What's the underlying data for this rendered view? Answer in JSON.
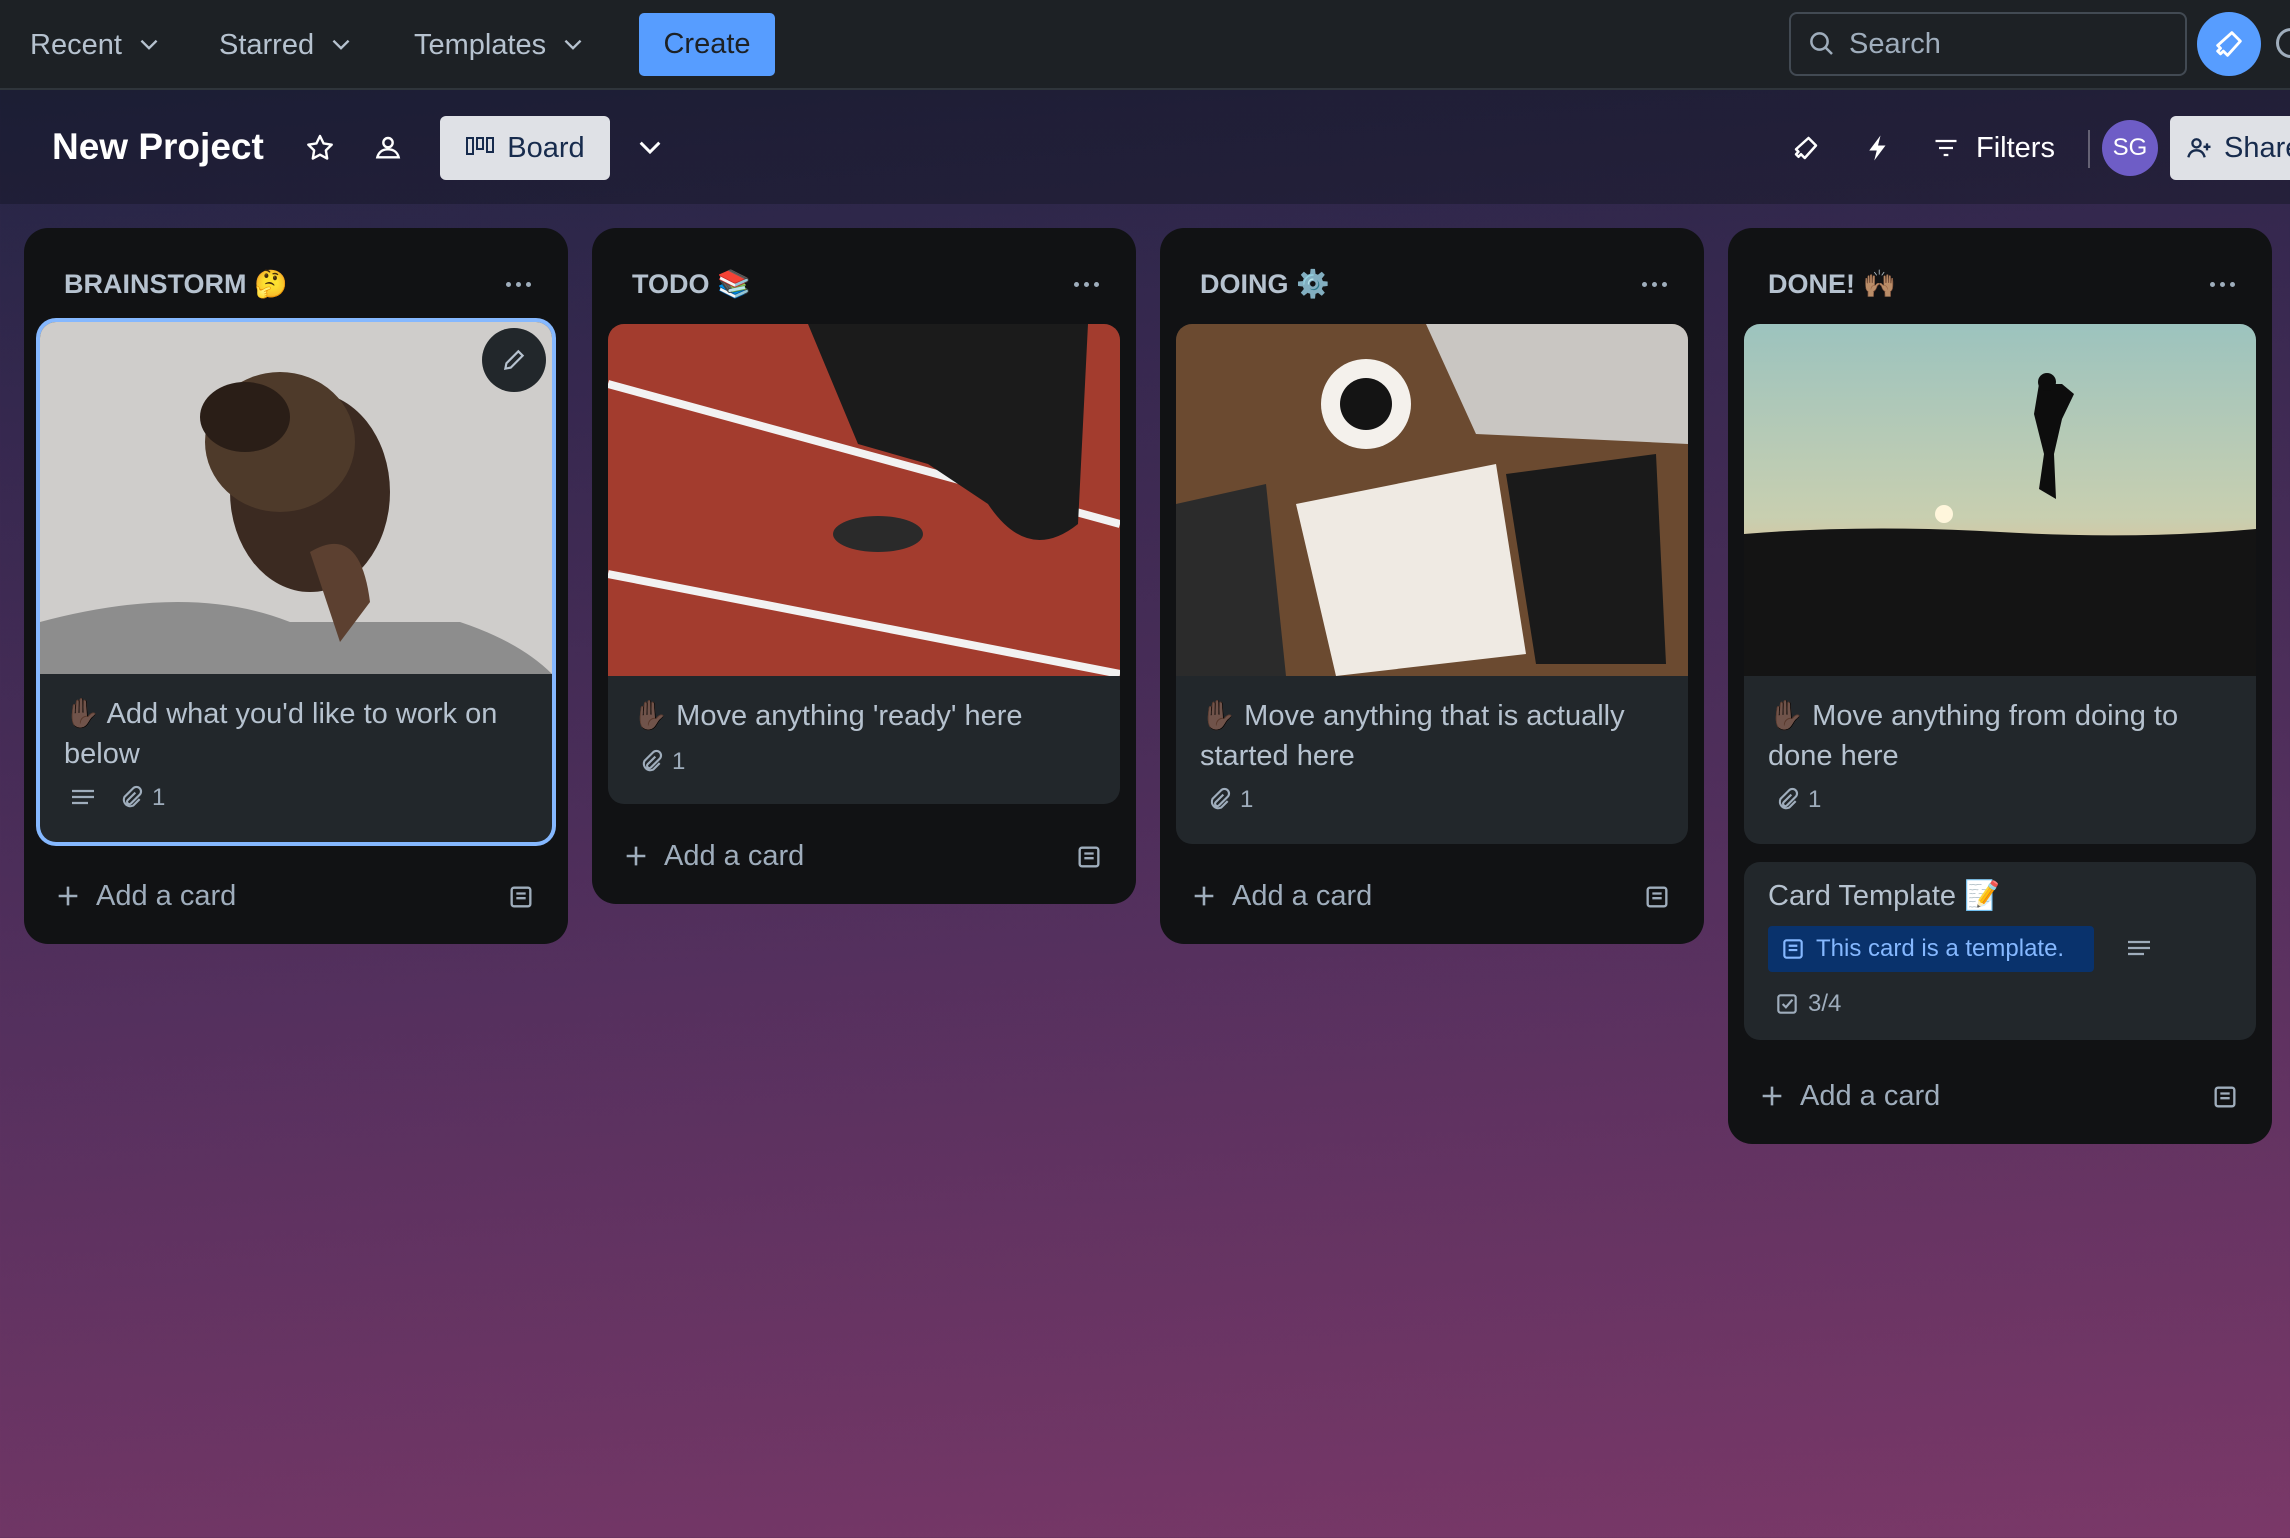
{
  "topnav": {
    "menus": [
      {
        "label": "Recent"
      },
      {
        "label": "Starred"
      },
      {
        "label": "Templates"
      }
    ],
    "create_label": "Create",
    "search_placeholder": "Search"
  },
  "board": {
    "title": "New Project",
    "view_label": "Board",
    "filters_label": "Filters",
    "avatar_initials": "SG",
    "share_label": "Share"
  },
  "lists": [
    {
      "title": "BRAINSTORM 🤔",
      "cards": [
        {
          "text": "✋🏿 Add what you'd like to work on below",
          "attachments": "1",
          "has_description": true
        }
      ],
      "add_card_label": "Add a card"
    },
    {
      "title": "TODO 📚",
      "cards": [
        {
          "text": "✋🏿 Move anything 'ready' here",
          "attachments": "1"
        }
      ],
      "add_card_label": "Add a card"
    },
    {
      "title": "DOING ⚙️",
      "cards": [
        {
          "text": "✋🏿 Move anything that is actually started here",
          "attachments": "1"
        }
      ],
      "add_card_label": "Add a card"
    },
    {
      "title": "DONE! 🙌🏽",
      "cards": [
        {
          "text": "✋🏿 Move anything from doing to done here",
          "attachments": "1"
        },
        {
          "text": "Card Template 📝",
          "template_label": "This card is a template.",
          "checklist": "3/4",
          "has_description": true
        }
      ],
      "add_card_label": "Add a card"
    }
  ],
  "colors": {
    "accent": "#579dff",
    "nav_bg": "#1d2125",
    "list_bg": "#111214",
    "card_bg": "#22272b",
    "text": "#b6c2cf",
    "selected_outline": "#85b8ff"
  }
}
